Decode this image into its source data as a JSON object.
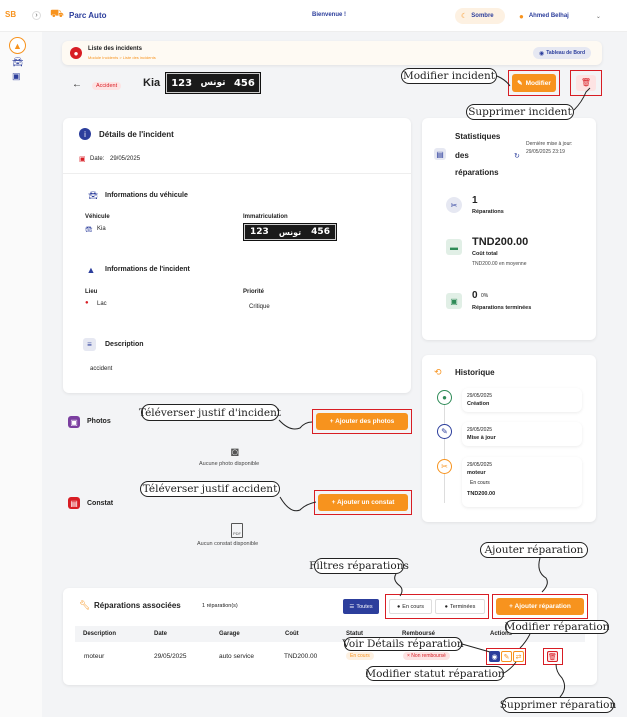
{
  "topbar": {
    "brand_logo": "SB",
    "expand": "›",
    "app_title": "Parc Auto",
    "welcome": "Bienvenue !",
    "theme": "Sombre",
    "user": "Ahmed Belhaj"
  },
  "header": {
    "title": "Liste des incidents",
    "breadcrumb": "Module Incidents > Liste des incidents",
    "dashboard_btn": "Tableau de Bord",
    "modify_btn": "Modifier"
  },
  "incident": {
    "type_badge": "Accident",
    "vehicle": "Kia",
    "plate_num": "123",
    "plate_ar": "تونس",
    "plate_num2": "456"
  },
  "details": {
    "title": "Détails de l'incident",
    "date_label": "Date:",
    "date": "29/05/2025",
    "veh_section": "Informations du véhicule",
    "veh_label": "Véhicule",
    "veh_value": "Kia",
    "immat_label": "Immatriculation",
    "inc_section": "Informations de l'incident",
    "lieu_label": "Lieu",
    "lieu_value": "Lac",
    "prio_label": "Priorité",
    "prio_value": "Critique",
    "desc_section": "Description",
    "desc_value": "accident"
  },
  "stats": {
    "title_l1": "Statistiques",
    "title_l2": "des",
    "title_l3": "réparations",
    "update": "Dernière mise à jour: 29/05/2025 23:19",
    "count": "1",
    "count_label": "Réparations",
    "cost": "TND200.00",
    "cost_label": "Coût total",
    "avg": "TND200.00 en moyenne",
    "pct": "0",
    "pct_unit": "0%",
    "done_label": "Réparations terminées"
  },
  "history": {
    "title": "Historique",
    "items": [
      {
        "date": "29/05/2025",
        "label": "Création"
      },
      {
        "date": "29/05/2025",
        "label": "Mise à jour"
      },
      {
        "date": "29/05/2025",
        "label": "moteur",
        "status": "En cours",
        "amount": "TND200.00"
      }
    ]
  },
  "photos": {
    "title": "Photos",
    "add_btn": "+ Ajouter des photos",
    "empty": "Aucune photo disponible"
  },
  "constat": {
    "title": "Constat",
    "add_btn": "+ Ajouter un constat",
    "empty": "Aucun constat disponible",
    "pdf": "PDF"
  },
  "repairs": {
    "title": "Réparations associées",
    "count": "1 réparation(s)",
    "filter_all": "Toutes",
    "filter_progress": "En cours",
    "filter_done": "Terminées",
    "add_btn": "+ Ajouter réparation",
    "columns": [
      "Description",
      "Date",
      "Garage",
      "Coût",
      "Statut",
      "Remboursé",
      "Actions"
    ],
    "rows": [
      {
        "desc": "moteur",
        "date": "29/05/2025",
        "garage": "auto service",
        "cost": "TND200.00",
        "status": "En cours",
        "refund": "× Non remboursé"
      }
    ]
  },
  "callouts": {
    "modify_incident": "Modifier incident",
    "delete_incident": "Supprimer incident",
    "upload_incident": "Téléverser justif d'incident",
    "upload_accident": "Téléverser justif accident",
    "filters": "Filtres réparations",
    "add_repair": "Ajouter réparation",
    "modify_repair": "Modifier réparation",
    "view_repair": "Voir Détails réparation",
    "status_repair": "Modifier statut réparation",
    "delete_repair": "Supprimer réparation"
  },
  "colors": {
    "accent": "#f7931e",
    "danger": "#d81d24",
    "primary": "#2c3e9c"
  }
}
